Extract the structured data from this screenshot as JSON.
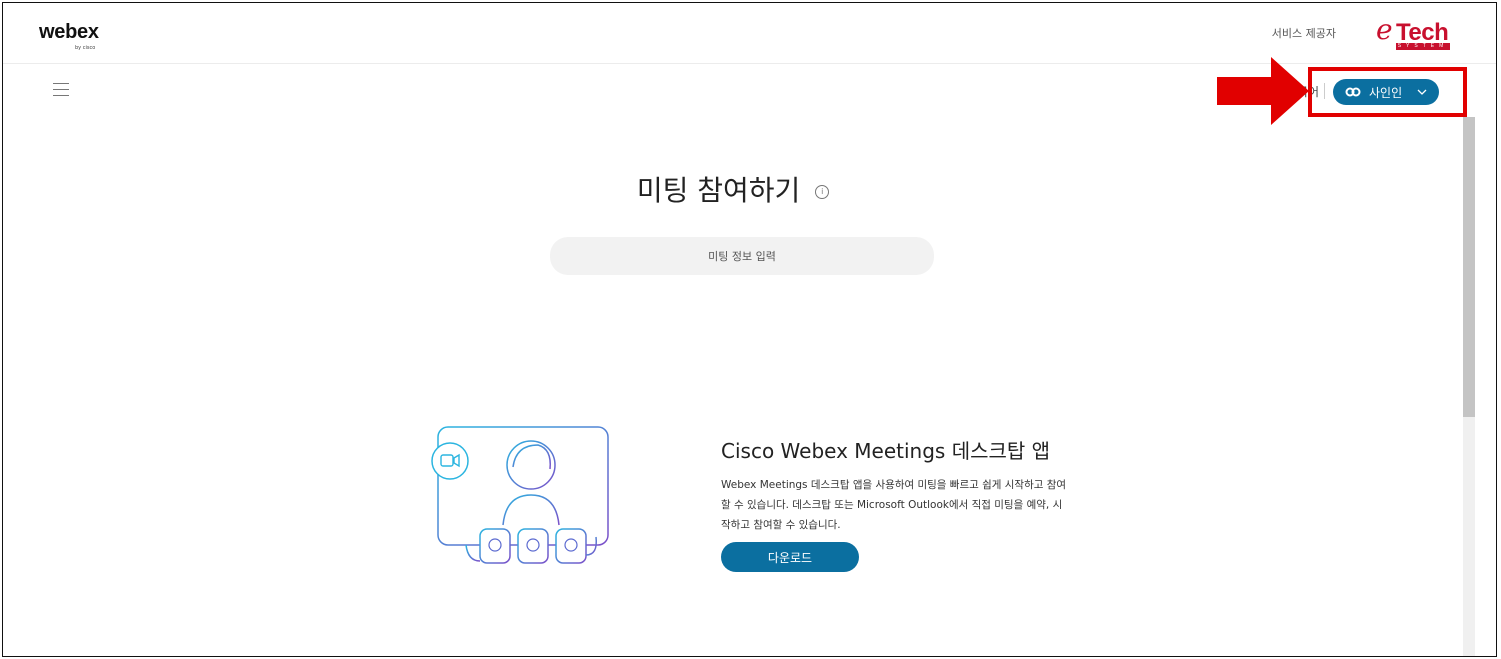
{
  "header": {
    "logo_text": "webex",
    "logo_sub": "by cisco",
    "provider_label": "서비스 제공자",
    "partner_logo": {
      "e": "e",
      "tech": "Tech",
      "system": "SYSTEM",
      "color": "#c8102e"
    }
  },
  "nav": {
    "language_label": "국어",
    "signin_label": "사인인",
    "signin_color": "#0b6fa0"
  },
  "main": {
    "title": "미팅 참여하기",
    "meeting_input_placeholder": "미팅 정보 입력"
  },
  "promo": {
    "title": "Cisco Webex Meetings 데스크탑 앱",
    "description": "Webex Meetings 데스크탑 앱을 사용하여 미팅을 빠르고 쉽게 시작하고 참여할 수 있습니다. 데스크탑 또는 Microsoft Outlook에서 직접 미팅을 예약, 시작하고 참여할 수 있습니다.",
    "download_label": "다운로드"
  },
  "annotation": {
    "highlight_color": "#e10000"
  }
}
